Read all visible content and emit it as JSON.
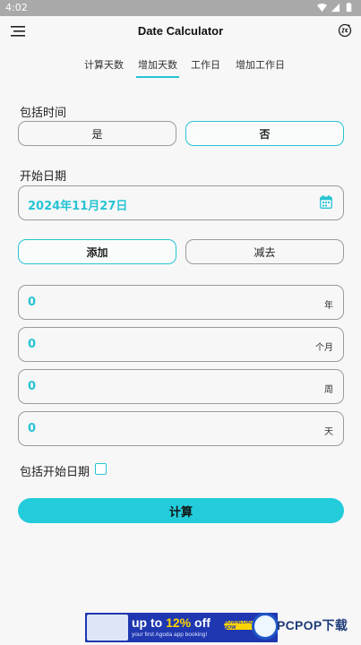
{
  "status_bar": {
    "time": "4:02"
  },
  "header": {
    "title": "Date Calculator"
  },
  "tabs": [
    {
      "label": "计算天数"
    },
    {
      "label": "增加天数"
    },
    {
      "label": "工作日"
    },
    {
      "label": "增加工作日"
    }
  ],
  "active_tab": "增加天数",
  "include_time": {
    "label": "包括时间",
    "options": [
      {
        "label": "是"
      },
      {
        "label": "否"
      }
    ],
    "selected": "否"
  },
  "start_date": {
    "label": "开始日期",
    "value": "2024年11月27日"
  },
  "operation": {
    "options": [
      {
        "label": "添加"
      },
      {
        "label": "减去"
      }
    ],
    "selected": "添加"
  },
  "fields": [
    {
      "value": "0",
      "unit": "年"
    },
    {
      "value": "0",
      "unit": "个月"
    },
    {
      "value": "0",
      "unit": "周"
    },
    {
      "value": "0",
      "unit": "天"
    }
  ],
  "include_start": {
    "label": "包括开始日期",
    "checked": false
  },
  "calculate": {
    "label": "计算"
  },
  "ad": {
    "headline_prefix": "up to ",
    "headline_percent": "12%",
    "headline_suffix": " off",
    "subline": "your first Agoda app booking!",
    "cta": "DOWNLOAD NOW"
  },
  "watermark": {
    "text": "PCPOP下载"
  },
  "colors": {
    "accent": "#27c4d3",
    "background": "#f7f7f8",
    "border": "#9b9b9b",
    "ad_bg": "#1f37b0"
  }
}
